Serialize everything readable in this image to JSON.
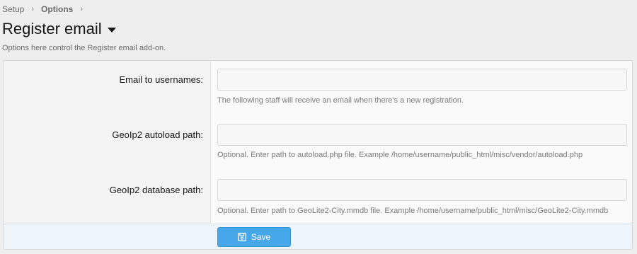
{
  "breadcrumb": {
    "items": [
      "Setup",
      "Options"
    ],
    "separator": "›"
  },
  "page": {
    "title": "Register email",
    "description": "Options here control the Register email add-on."
  },
  "options": [
    {
      "label": "Email to usernames:",
      "value": "",
      "hint": "The following staff will receive an email when there's a new registration."
    },
    {
      "label": "GeoIp2 autoload path:",
      "value": "",
      "hint": "Optional. Enter path to autoload.php file. Example /home/username/public_html/misc/vendor/autoload.php"
    },
    {
      "label": "GeoIp2 database path:",
      "value": "",
      "hint": "Optional. Enter path to GeoLite2-City.mmdb file. Example /home/username/public_html/misc/GeoLite2-City.mmdb"
    }
  ],
  "footer": {
    "save_label": "Save",
    "save_icon": "save-icon"
  },
  "colors": {
    "accent": "#47a7eb",
    "footer_bg": "#edf4fa"
  }
}
